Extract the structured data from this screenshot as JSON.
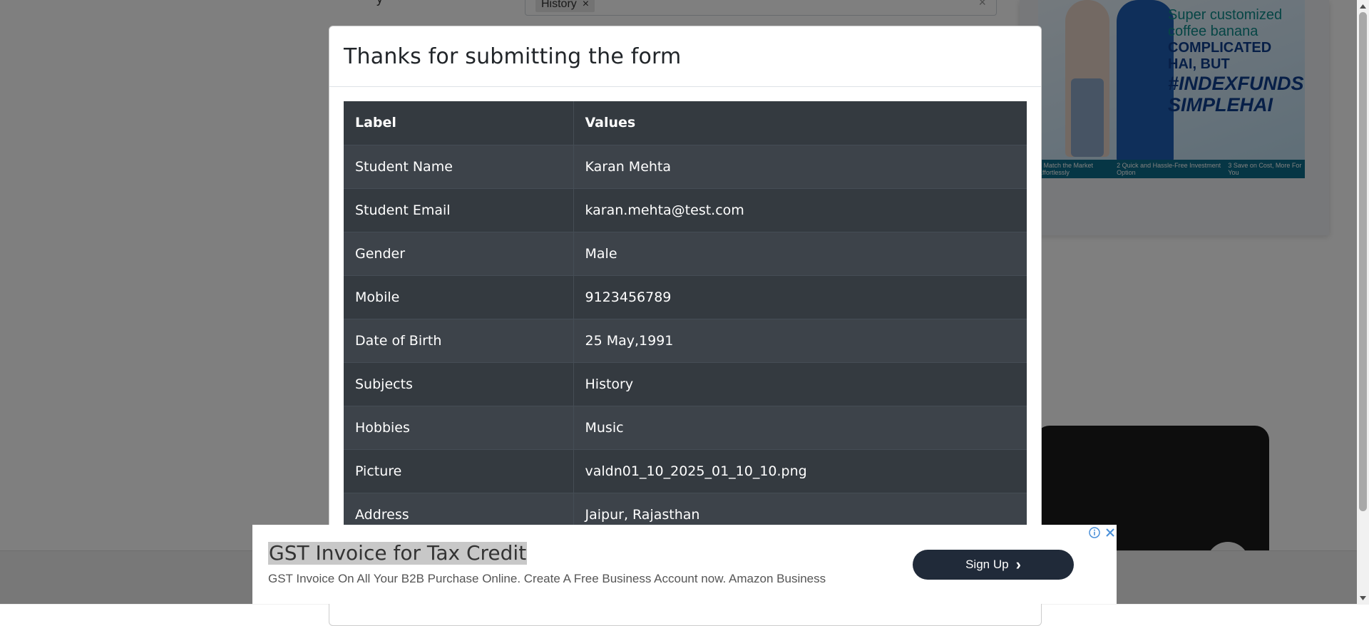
{
  "background_page": {
    "subject_chip_label": "History",
    "subject_chip_remove": "×",
    "subject_clear": "×",
    "field_label_fragment": "y",
    "ad_card": {
      "line1": "Super customized coffee banana",
      "line2": "COMPLICATED HAI, BUT",
      "line3": "#INDEXFUNDS SIMPLEHAI",
      "steps": [
        "1 Match the Market Effortlessly",
        "2 Quick and Hassle-Free Investment Option",
        "3 Save on Cost, More For You"
      ]
    }
  },
  "modal": {
    "title": "Thanks for submitting the form",
    "table": {
      "headers": [
        "Label",
        "Values"
      ],
      "rows": [
        {
          "label": "Student Name",
          "value": "Karan Mehta"
        },
        {
          "label": "Student Email",
          "value": "karan.mehta@test.com"
        },
        {
          "label": "Gender",
          "value": "Male"
        },
        {
          "label": "Mobile",
          "value": "9123456789"
        },
        {
          "label": "Date of Birth",
          "value": "25 May,1991"
        },
        {
          "label": "Subjects",
          "value": "History"
        },
        {
          "label": "Hobbies",
          "value": "Music"
        },
        {
          "label": "Picture",
          "value": "valdn01_10_2025_01_10_10.png"
        },
        {
          "label": "Address",
          "value": "Jaipur, Rajasthan"
        }
      ]
    }
  },
  "ad_banner": {
    "title": "GST Invoice for Tax Credit",
    "description": "GST Invoice On All Your B2B Purchase Online. Create A Free Business Account now. Amazon Business",
    "cta_label": "Sign Up",
    "cta_chevron": "›",
    "info_icon": "info-icon",
    "close_icon": "close-icon",
    "accent_color": "#202a39",
    "icon_color": "#4a90d9"
  },
  "colors": {
    "table_dark": "#343a40",
    "table_dark_alt": "#3d434a",
    "overlay": "rgba(0,0,0,0.5)"
  }
}
